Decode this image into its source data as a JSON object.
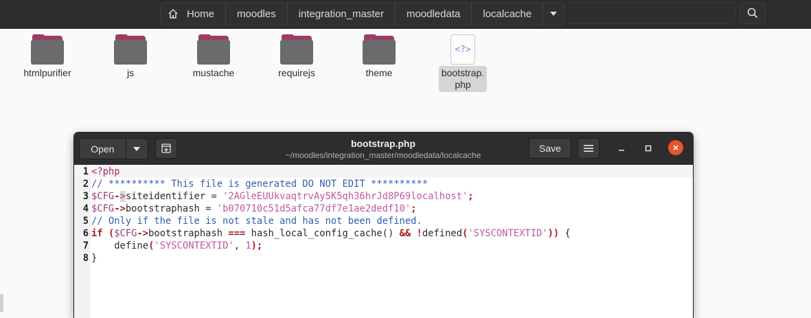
{
  "file_manager": {
    "breadcrumbs": [
      "Home",
      "moodles",
      "integration_master",
      "moodledata",
      "localcache"
    ],
    "items": [
      {
        "label": "htmlpurifier",
        "kind": "folder"
      },
      {
        "label": "js",
        "kind": "folder"
      },
      {
        "label": "mustache",
        "kind": "folder"
      },
      {
        "label": "requirejs",
        "kind": "folder"
      },
      {
        "label": "theme",
        "kind": "folder"
      },
      {
        "label": "bootstrap.\nphp",
        "kind": "file",
        "glyph": "<?>"
      }
    ]
  },
  "editor": {
    "open_label": "Open",
    "save_label": "Save",
    "title": "bootstrap.php",
    "subtitle": "~/moodles/integration_master/moodledata/localcache",
    "current_line": 1,
    "lines": [
      [
        [
          "t-tag",
          "<?php"
        ]
      ],
      [
        [
          "t-cm",
          "// ********** This file is generated DO NOT EDIT **********"
        ]
      ],
      [
        [
          "t-var",
          "$CFG"
        ],
        [
          "t-op",
          "-"
        ],
        [
          "cursor-mark",
          ">"
        ],
        [
          "t-plain",
          "siteidentifier = "
        ],
        [
          "t-str",
          "'2AGleEUUkvaqtrvAy5K5qh36hrJd8P69localhost'"
        ],
        [
          "t-op",
          ";"
        ]
      ],
      [
        [
          "t-var",
          "$CFG"
        ],
        [
          "t-op",
          "->"
        ],
        [
          "t-plain",
          "bootstraphash = "
        ],
        [
          "t-str",
          "'b070710c51d5afca77df7e1ae2dedf10'"
        ],
        [
          "t-op",
          ";"
        ]
      ],
      [
        [
          "t-cm",
          "// Only if the file is not stale and has not been defined."
        ]
      ],
      [
        [
          "t-kw",
          "if"
        ],
        [
          "t-plain",
          " "
        ],
        [
          "t-op",
          "("
        ],
        [
          "t-var",
          "$CFG"
        ],
        [
          "t-op",
          "->"
        ],
        [
          "t-plain",
          "bootstraphash "
        ],
        [
          "t-op",
          "==="
        ],
        [
          "t-plain",
          " hash_local_config_cache() "
        ],
        [
          "t-op",
          "&&"
        ],
        [
          "t-plain",
          " "
        ],
        [
          "t-op",
          "!"
        ],
        [
          "t-plain",
          "defined"
        ],
        [
          "t-op",
          "("
        ],
        [
          "t-str",
          "'SYSCONTEXTID'"
        ],
        [
          "t-op",
          "))"
        ],
        [
          "t-plain",
          " {"
        ]
      ],
      [
        [
          "t-plain",
          "    define"
        ],
        [
          "t-op",
          "("
        ],
        [
          "t-str",
          "'SYSCONTEXTID'"
        ],
        [
          "t-plain",
          ", "
        ],
        [
          "t-num",
          "1"
        ],
        [
          "t-op",
          ");"
        ]
      ],
      [
        [
          "t-plain",
          "}"
        ]
      ]
    ]
  },
  "colors": {
    "folder_accent": "#9d3d66",
    "close_button": "#e9542c",
    "header_bg": "#2c2c2c"
  }
}
